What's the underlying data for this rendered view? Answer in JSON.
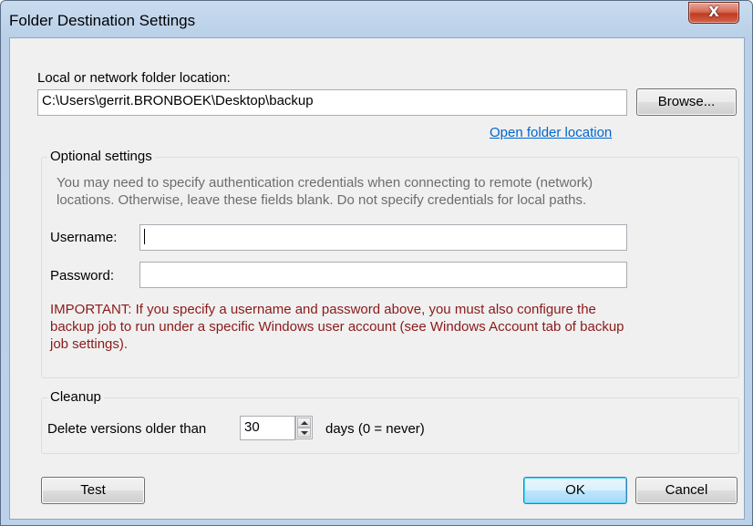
{
  "window": {
    "title": "Folder Destination Settings",
    "close_label": "X"
  },
  "location": {
    "label": "Local or network folder location:",
    "value": "C:\\Users\\gerrit.BRONBOEK\\Desktop\\backup",
    "browse_label": "Browse...",
    "open_link": "Open folder location"
  },
  "optional": {
    "title": "Optional settings",
    "hint_line1": "You may need to specify authentication credentials when connecting to remote (network)",
    "hint_line2": "locations. Otherwise, leave these fields blank. Do not specify credentials for local paths.",
    "username_label": "Username:",
    "username_value": "",
    "password_label": "Password:",
    "password_value": "",
    "important_line1": "IMPORTANT: If you specify a username and password above, you must also configure the",
    "important_line2": "backup job to run under a specific Windows user account (see Windows Account tab of backup",
    "important_line3": "job settings)."
  },
  "cleanup": {
    "title": "Cleanup",
    "label_before": "Delete versions older than",
    "days_value": "30",
    "label_after": "days (0 = never)"
  },
  "footer": {
    "test_label": "Test",
    "ok_label": "OK",
    "cancel_label": "Cancel"
  },
  "icons": {
    "close": "close-icon",
    "spin_up": "chevron-up-icon",
    "spin_down": "chevron-down-icon"
  }
}
